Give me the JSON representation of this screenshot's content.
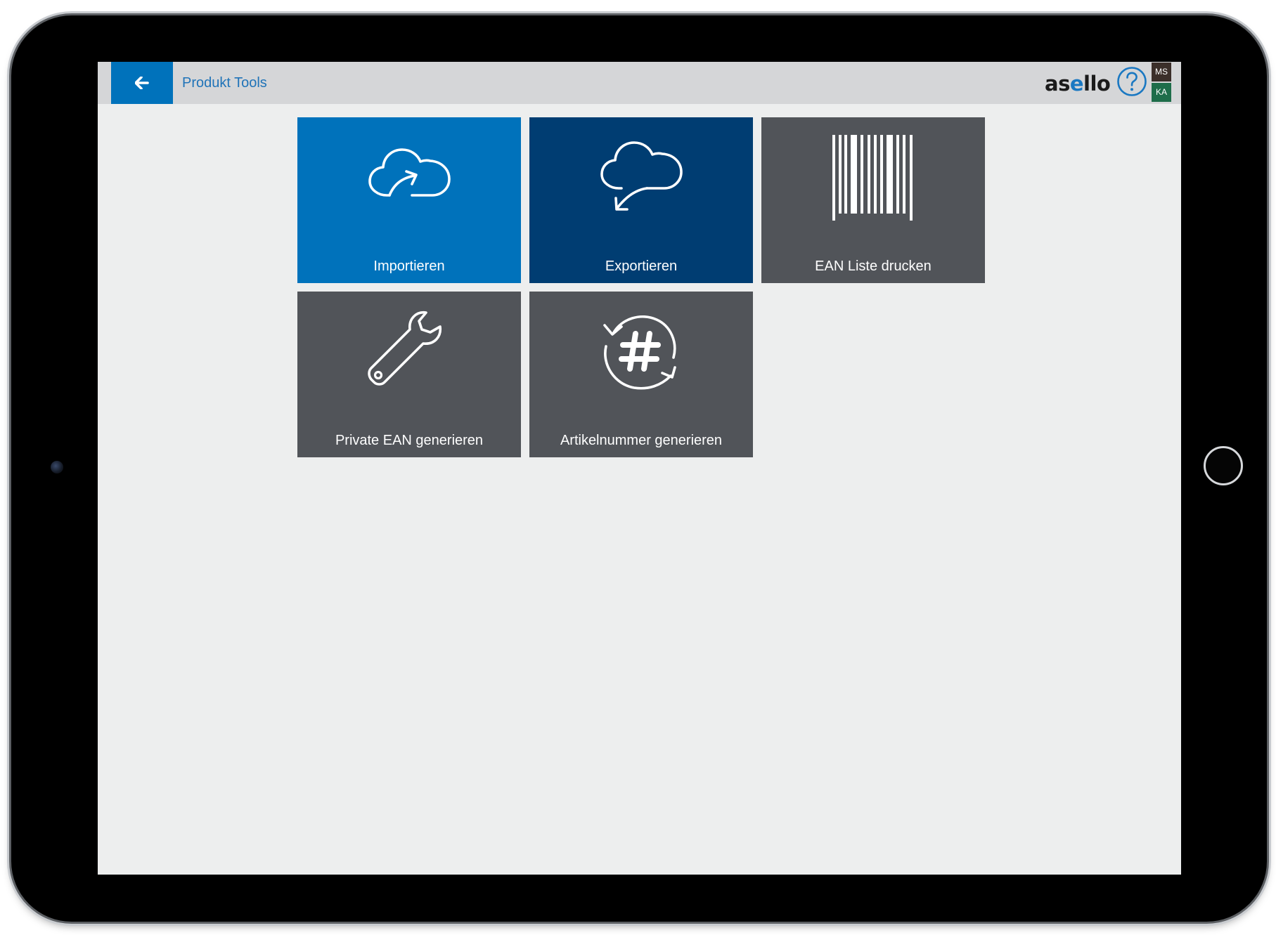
{
  "header": {
    "title": "Produkt Tools",
    "logo": {
      "part1": "as",
      "part2": "e",
      "part3": "llo"
    },
    "back_icon": "arrow-left-icon",
    "help_icon": "question-circle-icon"
  },
  "users": [
    {
      "initials": "MS",
      "color": "#3b2f2a"
    },
    {
      "initials": "KA",
      "color": "#1e6d4a"
    }
  ],
  "tiles": [
    {
      "label": "Importieren",
      "icon": "cloud-upload-icon",
      "color": "#0072bb"
    },
    {
      "label": "Exportieren",
      "icon": "cloud-download-icon",
      "color": "#003d72"
    },
    {
      "label": "EAN Liste drucken",
      "icon": "barcode-icon",
      "color": "#515459"
    },
    {
      "label": "Private EAN generieren",
      "icon": "wrench-icon",
      "color": "#515459"
    },
    {
      "label": "Artikelnummer generieren",
      "icon": "hash-refresh-icon",
      "color": "#515459"
    }
  ],
  "colors": {
    "accent": "#0072bb",
    "logo_accent": "#1a78c2",
    "screen_background": "#edeeee",
    "topbar_background": "#d5d6d8"
  }
}
